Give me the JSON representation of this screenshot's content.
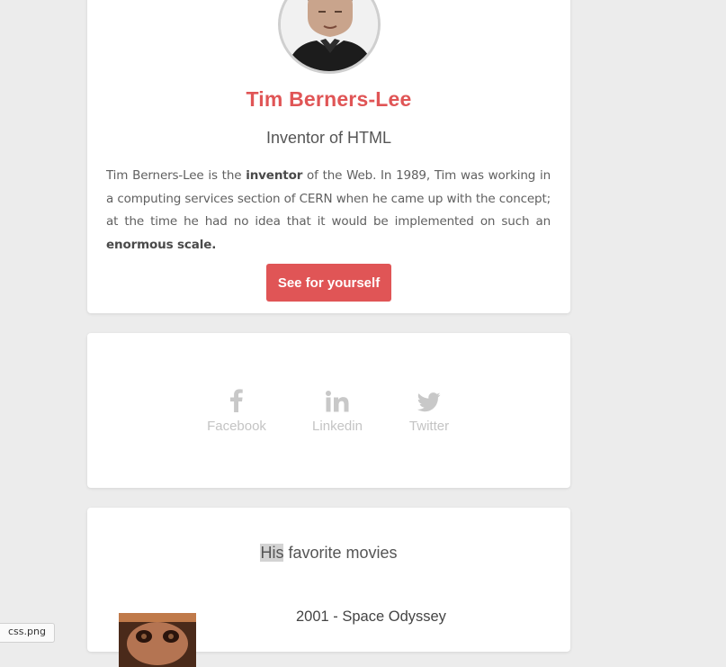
{
  "profile": {
    "name": "Tim Berners-Lee",
    "title": "Inventor of HTML",
    "bio": {
      "part1": "Tim Berners-Lee is the ",
      "bold1": "inventor",
      "part2": " of the Web. In 1989, Tim was working in a computing services section of CERN when he came up with the concept; at the time he had no idea that it would be implemented on such an ",
      "bold2": "enormous scale."
    },
    "cta_label": "See for yourself"
  },
  "social": [
    {
      "label": "Facebook",
      "icon": "facebook-icon"
    },
    {
      "label": "Linkedin",
      "icon": "linkedin-icon"
    },
    {
      "label": "Twitter",
      "icon": "twitter-icon"
    }
  ],
  "movies": {
    "heading_highlight": "His",
    "heading_rest": " favorite movies",
    "items": [
      {
        "title": "2001 - Space Odyssey"
      }
    ]
  },
  "download_bar": {
    "file": "css.png"
  },
  "colors": {
    "accent": "#e05556",
    "background": "#ececec",
    "social_icon": "#c8c8c8"
  }
}
